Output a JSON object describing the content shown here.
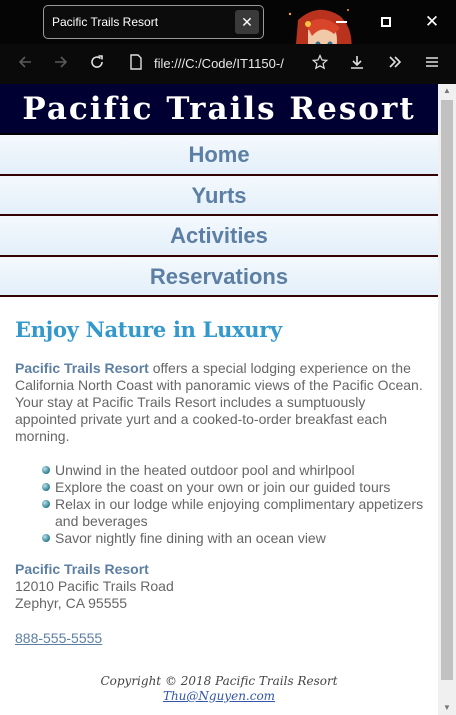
{
  "browser": {
    "tab_title": "Pacific Trails Resort",
    "tab_close_glyph": "✕",
    "url": "file:///C:/Code/IT1150-/",
    "icons": [
      "back-arrow-icon",
      "forward-arrow-icon",
      "reload-icon",
      "page-icon",
      "star-icon",
      "download-icon",
      "overflow-chevrons-icon",
      "menu-icon"
    ],
    "window_controls": [
      "minimize",
      "maximize",
      "close"
    ]
  },
  "site": {
    "title": "Pacific Trails Resort",
    "nav": [
      "Home",
      "Yurts",
      "Activities",
      "Reservations"
    ],
    "colors": {
      "header_bg": "#000033",
      "link": "#5c7fa3",
      "heading": "#3399cc",
      "nav_border": "#330000"
    }
  },
  "main": {
    "heading": "Enjoy Nature in Luxury",
    "intro_strong": "Pacific Trails Resort",
    "intro_rest": " offers a special lodging experience on the California North Coast with panoramic views of the Pacific Ocean. Your stay at Pacific Trails Resort includes a sumptuously appointed private yurt and a cooked-to-order breakfast each morning.",
    "features": [
      "Unwind in the heated outdoor pool and whirlpool",
      "Explore the coast on your own or join our guided tours",
      "Relax in our lodge while enjoying complimentary appetizers and beverages",
      "Savor nightly fine dining with an ocean view"
    ],
    "contact": {
      "name": "Pacific Trails Resort",
      "street": "12010 Pacific Trails Road",
      "city": "Zephyr, CA 95555",
      "phone": "888-555-5555"
    }
  },
  "footer": {
    "copyright": "Copyright © 2018 Pacific Trails Resort",
    "email": "Thu@Nguyen.com"
  }
}
